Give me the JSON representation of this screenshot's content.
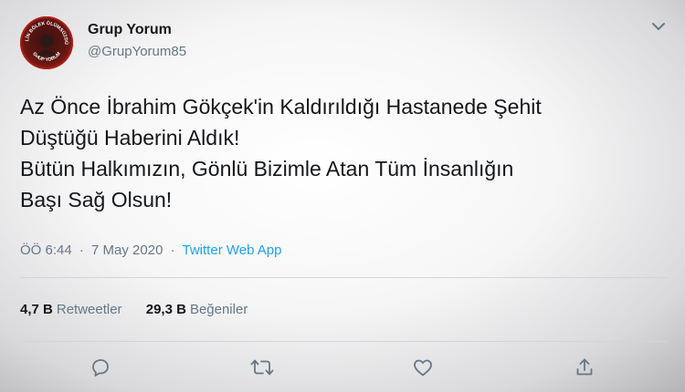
{
  "author": {
    "name": "Grup Yorum",
    "handle": "@GrupYorum85",
    "avatar_text_top": "HELİN BÖLEK ÖLÜMSÜZDÜR",
    "avatar_text_bottom": "GRUP YORUM"
  },
  "tweet": {
    "lines": [
      "Az Önce İbrahim Gökçek'in Kaldırıldığı Hastanede Şehit",
      "Düştüğü Haberini Aldık!",
      "Bütün Halkımızın, Gönlü Bizimle Atan Tüm İnsanlığın",
      "Başı Sağ Olsun!"
    ],
    "time": "ÖÖ 6:44",
    "separator": "·",
    "date": "7 May 2020",
    "source": "Twitter Web App"
  },
  "stats": {
    "retweets_count": "4,7 B",
    "retweets_label": "Retweetler",
    "likes_count": "29,3 B",
    "likes_label": "Beğeniler"
  },
  "icons": {
    "menu": "chevron-down-icon",
    "reply": "reply-icon",
    "retweet": "retweet-icon",
    "like": "heart-icon",
    "share": "share-icon"
  },
  "colors": {
    "link": "#1da1f2",
    "secondary_text": "#657786",
    "icon": "#657786"
  }
}
